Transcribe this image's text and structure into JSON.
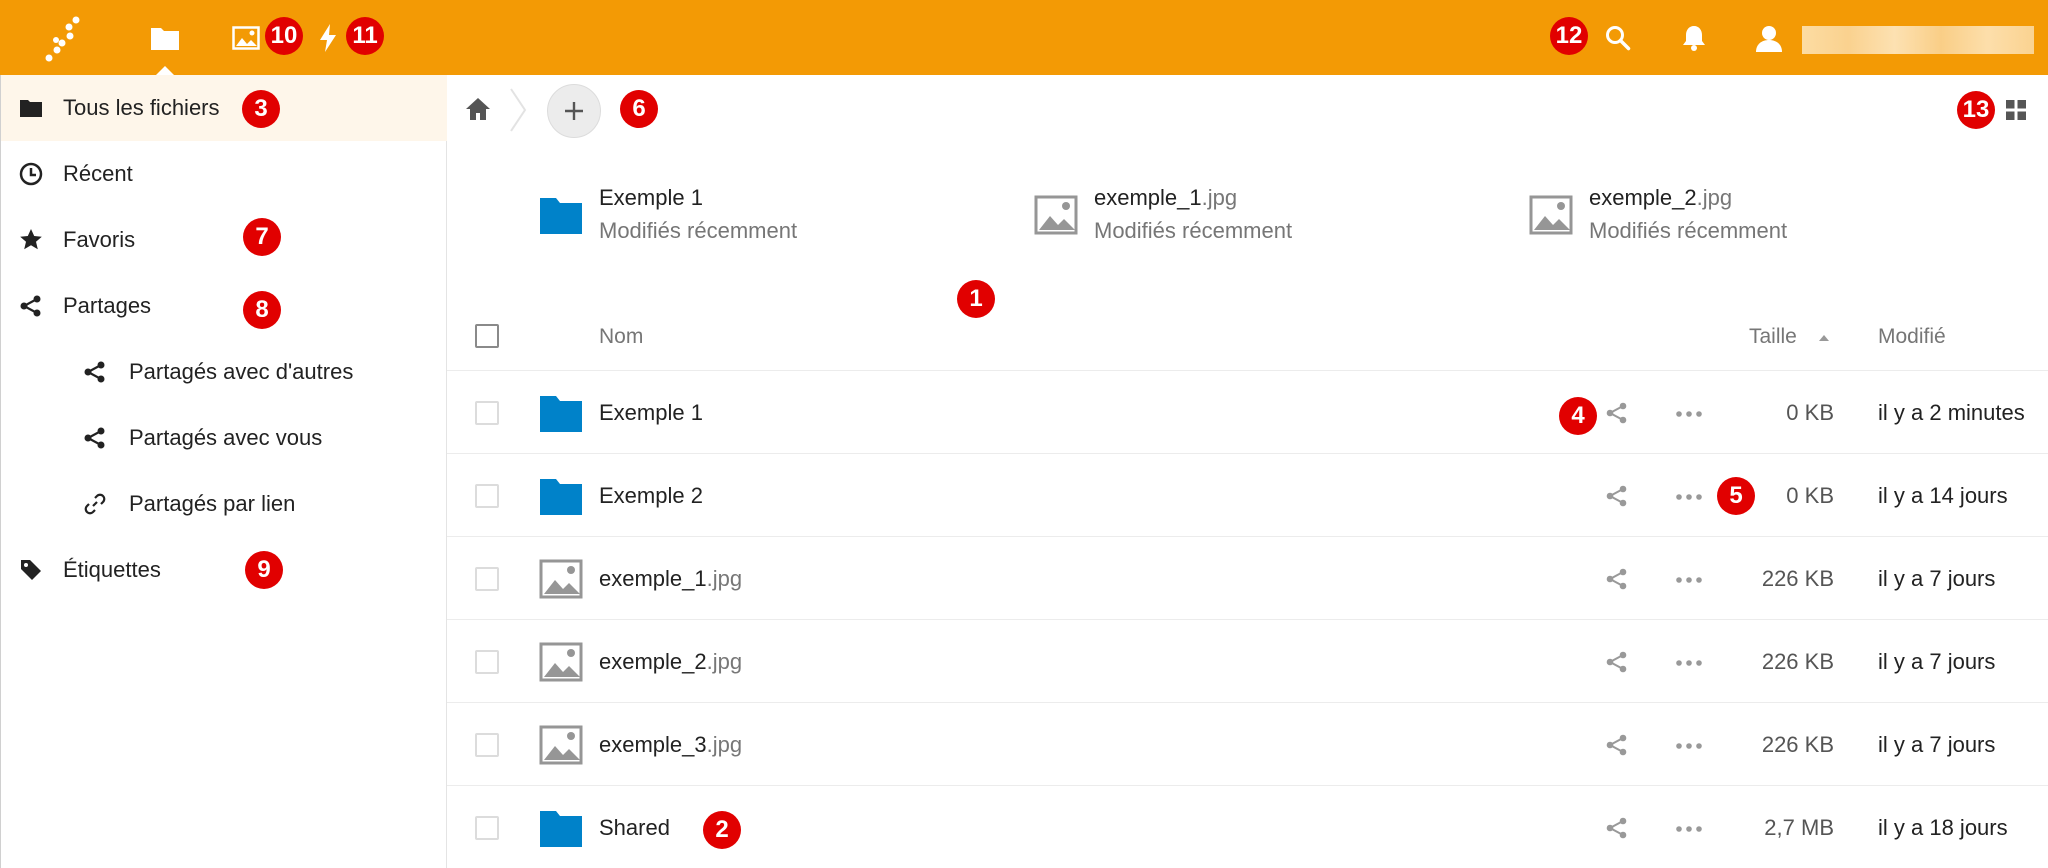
{
  "colors": {
    "brand": "#f39a05",
    "folder": "#0082c9",
    "badge": "#e10000"
  },
  "header": {
    "logo_icon": "nextcloud-logo-icon",
    "apps": [
      {
        "name": "files",
        "icon": "folder-icon"
      },
      {
        "name": "gallery",
        "icon": "image-icon"
      },
      {
        "name": "activity",
        "icon": "lightning-icon"
      }
    ],
    "right_icons": [
      "search-icon",
      "bell-icon",
      "user-icon"
    ]
  },
  "sidebar": {
    "items": [
      {
        "label": "Tous les fichiers",
        "icon": "folder-icon"
      },
      {
        "label": "Récent",
        "icon": "clock-icon"
      },
      {
        "label": "Favoris",
        "icon": "star-icon"
      },
      {
        "label": "Partages",
        "icon": "share-icon"
      },
      {
        "label": "Partagés avec d'autres",
        "icon": "share-icon"
      },
      {
        "label": "Partagés avec vous",
        "icon": "share-icon"
      },
      {
        "label": "Partagés par lien",
        "icon": "link-icon"
      },
      {
        "label": "Étiquettes",
        "icon": "tag-icon"
      }
    ]
  },
  "recent": [
    {
      "name": "Exemple 1",
      "ext": "",
      "sub": "Modifiés récemment",
      "icon": "folder-icon"
    },
    {
      "name": "exemple_1",
      "ext": ".jpg",
      "sub": "Modifiés récemment",
      "icon": "image-icon"
    },
    {
      "name": "exemple_2",
      "ext": ".jpg",
      "sub": "Modifiés récemment",
      "icon": "image-icon"
    }
  ],
  "table": {
    "headers": {
      "name": "Nom",
      "size": "Taille",
      "modified": "Modifié"
    },
    "rows": [
      {
        "name": "Exemple 1",
        "ext": "",
        "size": "0 KB",
        "modified": "il y a 2 minutes",
        "icon": "folder-icon"
      },
      {
        "name": "Exemple 2",
        "ext": "",
        "size": "0 KB",
        "modified": "il y a 14 jours",
        "icon": "folder-icon"
      },
      {
        "name": "exemple_1",
        "ext": ".jpg",
        "size": "226 KB",
        "modified": "il y a 7 jours",
        "icon": "image-icon"
      },
      {
        "name": "exemple_2",
        "ext": ".jpg",
        "size": "226 KB",
        "modified": "il y a 7 jours",
        "icon": "image-icon"
      },
      {
        "name": "exemple_3",
        "ext": ".jpg",
        "size": "226 KB",
        "modified": "il y a 7 jours",
        "icon": "image-icon"
      },
      {
        "name": "Shared",
        "ext": "",
        "size": "2,7 MB",
        "modified": "il y a 18 jours",
        "icon": "folder-icon"
      }
    ]
  },
  "annotations": [
    "1",
    "2",
    "3",
    "4",
    "5",
    "6",
    "7",
    "8",
    "9",
    "10",
    "11",
    "12",
    "13"
  ]
}
